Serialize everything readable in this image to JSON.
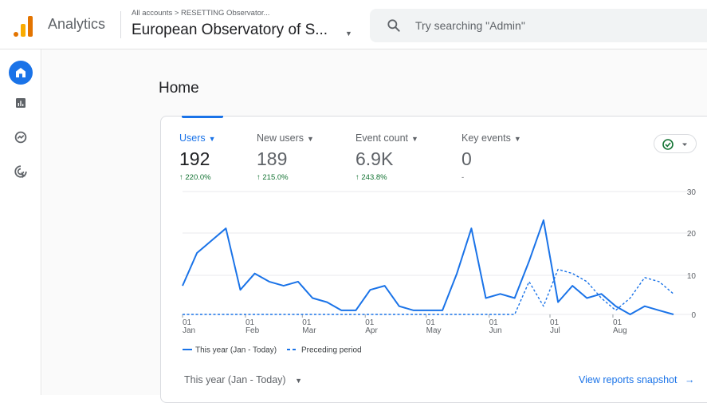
{
  "header": {
    "app_name": "Analytics",
    "breadcrumb": "All accounts > RESETTING Observator...",
    "property_name": "European Observatory of S...",
    "search_placeholder": "Try searching \"Admin\""
  },
  "sidebar": {
    "items": [
      {
        "name": "home-icon",
        "active": true
      },
      {
        "name": "reports-icon",
        "active": false
      },
      {
        "name": "explore-icon",
        "active": false
      },
      {
        "name": "advertising-icon",
        "active": false
      }
    ]
  },
  "page": {
    "title": "Home"
  },
  "metrics": [
    {
      "label": "Users",
      "value": "192",
      "delta": "↑ 220.0%"
    },
    {
      "label": "New users",
      "value": "189",
      "delta": "↑ 215.0%"
    },
    {
      "label": "Event count",
      "value": "6.9K",
      "delta": "↑ 243.8%"
    },
    {
      "label": "Key events",
      "value": "0",
      "delta": "-"
    }
  ],
  "footer": {
    "range_label": "This year (Jan - Today)",
    "link_label": "View reports snapshot"
  },
  "colors": {
    "accent": "#1a73e8",
    "positive": "#137333",
    "brand_orange": "#e37400"
  },
  "chart_data": {
    "type": "line",
    "y_ticks": [
      "30",
      "20",
      "10",
      "0"
    ],
    "ylim": [
      0,
      30
    ],
    "x_ticks": [
      {
        "top": "01",
        "bottom": "Jan",
        "t": 0
      },
      {
        "top": "01",
        "bottom": "Feb",
        "t": 0.1454
      },
      {
        "top": "01",
        "bottom": "Mar",
        "t": 0.2768
      },
      {
        "top": "01",
        "bottom": "Apr",
        "t": 0.4222
      },
      {
        "top": "01",
        "bottom": "May",
        "t": 0.5629
      },
      {
        "top": "01",
        "bottom": "Jun",
        "t": 0.7083
      },
      {
        "top": "01",
        "bottom": "Jul",
        "t": 0.849
      },
      {
        "top": "01",
        "bottom": "Aug",
        "t": 0.9944
      }
    ],
    "series": [
      {
        "name": "This year (Jan - Today)",
        "style": "solid",
        "values": [
          7,
          15,
          18,
          21,
          6,
          10,
          8,
          7,
          8,
          4,
          3,
          1,
          1,
          6,
          7,
          2,
          1,
          1,
          1,
          10,
          21,
          4,
          5,
          4,
          13,
          23,
          3,
          7,
          4,
          5,
          2,
          0,
          2,
          1,
          0
        ]
      },
      {
        "name": "Preceding period",
        "style": "dashed",
        "values": [
          0,
          0,
          0,
          0,
          0,
          0,
          0,
          0,
          0,
          0,
          0,
          0,
          0,
          0,
          0,
          0,
          0,
          0,
          0,
          0,
          0,
          0,
          0,
          0,
          8,
          2,
          11,
          10,
          8,
          4,
          1,
          4,
          9,
          8,
          5
        ]
      }
    ]
  }
}
